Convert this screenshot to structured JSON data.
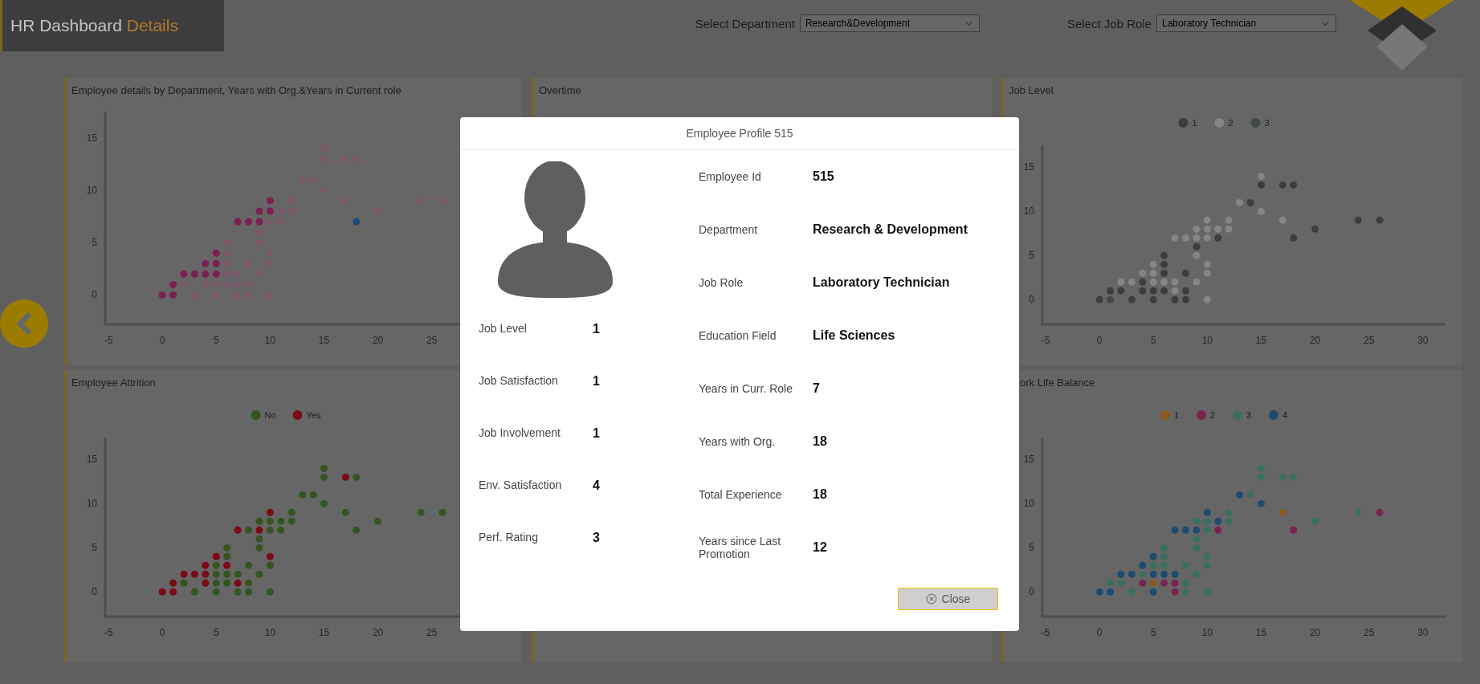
{
  "header": {
    "title": "HR Dashboard",
    "title_accent": "Details"
  },
  "filters": [
    {
      "label": "Select Department",
      "value": "Research&Development"
    },
    {
      "label": "Select Job Role",
      "value": "Laboratory Technician"
    }
  ],
  "panels": [
    {
      "title": "Employee details by Department, Years with Org.&Years in Current role",
      "chart_data": {
        "type": "scatter",
        "xlim": [
          -5.3,
          32.1
        ],
        "ylim": [
          -2.8,
          17.5
        ],
        "xticks": [
          -5,
          0,
          5,
          10,
          15,
          20,
          25
        ],
        "yticks": [
          0,
          5,
          10,
          15
        ],
        "series": [
          {
            "color": "#7d1f50",
            "x": [
              0,
              1,
              1,
              2,
              3,
              4,
              4,
              5,
              5,
              5,
              7,
              8,
              9,
              9,
              10,
              10
            ],
            "values": [
              0,
              0,
              1,
              2,
              2,
              2,
              3,
              4,
              3,
              2,
              7,
              7,
              7,
              8,
              9,
              8
            ]
          },
          {
            "color": "#1d4a7a",
            "x": [
              18
            ],
            "values": [
              7
            ]
          },
          {
            "color": "#7a5a6a",
            "x": [
              2,
              3,
              4,
              5,
              5,
              6,
              6,
              6,
              6,
              6,
              7,
              7,
              7,
              8,
              8,
              8,
              9,
              9,
              9,
              10,
              10,
              10,
              10,
              11,
              11,
              12,
              12,
              13,
              14,
              15,
              15,
              15,
              17,
              18,
              17,
              20,
              24,
              26
            ],
            "values": [
              1,
              0,
              1,
              1,
              0,
              5,
              4,
              3,
              2,
              1,
              2,
              1,
              0,
              3,
              1,
              0,
              6,
              5,
              2,
              7,
              4,
              3,
              0,
              8,
              7,
              9,
              8,
              11,
              11,
              14,
              13,
              10,
              13,
              13,
              9,
              8,
              9,
              9
            ]
          }
        ]
      }
    },
    {
      "title": "Overtime"
    },
    {
      "title": "Job Level",
      "chart_data": {
        "type": "scatter",
        "legend": "top",
        "xlim": [
          -5.3,
          32.1
        ],
        "ylim": [
          -2.8,
          17.5
        ],
        "xticks": [
          -5,
          0,
          5,
          10,
          15,
          20,
          25,
          30
        ],
        "yticks": [
          0,
          5,
          10,
          15
        ],
        "series": [
          {
            "name": "1",
            "color": "#3a3f3c",
            "x": [
              0,
              1,
              2,
              3,
              4,
              4,
              5,
              5,
              6,
              6,
              6,
              6,
              7,
              8,
              8,
              8,
              9,
              11,
              14,
              15,
              17,
              18,
              18,
              20,
              24,
              26
            ],
            "values": [
              0,
              1,
              1,
              0,
              2,
              1,
              1,
              0,
              5,
              4,
              3,
              1,
              0,
              3,
              1,
              0,
              6,
              7,
              11,
              13,
              13,
              13,
              7,
              8,
              9,
              9
            ]
          },
          {
            "name": "2",
            "color": "#858585",
            "x": [
              2,
              3,
              4,
              5,
              5,
              5,
              6,
              7,
              7,
              7,
              8,
              9,
              9,
              9,
              9,
              10,
              10,
              10,
              10,
              10,
              10,
              11,
              12,
              12,
              13,
              15,
              15,
              17
            ],
            "values": [
              2,
              2,
              3,
              4,
              3,
              2,
              2,
              2,
              1,
              7,
              7,
              7,
              8,
              5,
              2,
              9,
              8,
              7,
              4,
              3,
              0,
              8,
              9,
              8,
              11,
              14,
              10,
              9
            ]
          },
          {
            "name": "3",
            "color": "#434b48",
            "x": [
              1
            ],
            "values": [
              0
            ]
          }
        ]
      }
    },
    {
      "title": "Employee Attrition",
      "chart_data": {
        "type": "scatter",
        "legend": "top",
        "xlim": [
          -5.3,
          32.1
        ],
        "ylim": [
          -2.8,
          17.5
        ],
        "xticks": [
          -5,
          0,
          5,
          10,
          15,
          20,
          25
        ],
        "yticks": [
          0,
          5,
          10,
          15
        ],
        "series": [
          {
            "name": "No",
            "color": "#34551f",
            "x": [
              2,
              3,
              5,
              5,
              5,
              5,
              6,
              6,
              6,
              6,
              7,
              7,
              8,
              8,
              8,
              8,
              9,
              9,
              9,
              9,
              10,
              10,
              10,
              10,
              11,
              11,
              12,
              12,
              13,
              14,
              15,
              15,
              15,
              17,
              18,
              18,
              20,
              24,
              26
            ],
            "values": [
              1,
              0,
              3,
              2,
              1,
              0,
              5,
              4,
              2,
              1,
              2,
              0,
              7,
              3,
              1,
              0,
              8,
              6,
              5,
              2,
              8,
              7,
              3,
              0,
              8,
              7,
              9,
              8,
              11,
              11,
              14,
              13,
              10,
              9,
              13,
              7,
              8,
              9,
              9
            ]
          },
          {
            "name": "Yes",
            "color": "#7b0a17",
            "x": [
              0,
              1,
              1,
              2,
              3,
              4,
              4,
              4,
              5,
              6,
              7,
              7,
              9,
              10,
              10,
              17
            ],
            "values": [
              0,
              0,
              1,
              2,
              2,
              2,
              3,
              1,
              4,
              3,
              7,
              1,
              7,
              9,
              4,
              13
            ]
          }
        ]
      }
    },
    {
      "title": "ork Life Balance",
      "chart_data": {
        "type": "scatter",
        "legend": "top",
        "xlim": [
          -5.3,
          32.1
        ],
        "ylim": [
          -2.8,
          17.5
        ],
        "xticks": [
          -5,
          0,
          5,
          10,
          15,
          20,
          25,
          30
        ],
        "yticks": [
          0,
          5,
          10,
          15
        ],
        "series": [
          {
            "name": "1",
            "color": "#8a5a1e",
            "x": [
              5,
              17
            ],
            "values": [
              1,
              9
            ]
          },
          {
            "name": "2",
            "color": "#7a2350",
            "x": [
              4,
              6,
              7,
              7,
              11,
              18,
              26
            ],
            "values": [
              1,
              1,
              1,
              0,
              7,
              7,
              9
            ]
          },
          {
            "name": "3",
            "color": "#3a7060",
            "x": [
              1,
              2,
              3,
              4,
              5,
              6,
              6,
              6,
              8,
              8,
              8,
              9,
              9,
              9,
              9,
              10,
              10,
              10,
              10,
              10,
              12,
              12,
              14,
              15,
              15,
              17,
              18,
              20,
              24
            ],
            "values": [
              1,
              1,
              0,
              2,
              3,
              3,
              4,
              5,
              3,
              1,
              0,
              2,
              5,
              6,
              8,
              8,
              7,
              4,
              3,
              0,
              9,
              8,
              11,
              13,
              14,
              13,
              13,
              8,
              9
            ]
          },
          {
            "name": "4",
            "color": "#1e4c70",
            "x": [
              0,
              1,
              2,
              3,
              4,
              5,
              5,
              6,
              7,
              5,
              7,
              8,
              9,
              10,
              11,
              13,
              15
            ],
            "values": [
              0,
              0,
              2,
              2,
              3,
              4,
              2,
              2,
              2,
              0,
              7,
              7,
              7,
              9,
              8,
              11,
              10
            ]
          }
        ]
      }
    }
  ],
  "profile_dialog": {
    "title": "Employee Profile 515",
    "left_fields": [
      {
        "label": "Job Level",
        "value": "1"
      },
      {
        "label": "Job Satisfaction",
        "value": "1"
      },
      {
        "label": "Job Involvement",
        "value": "1"
      },
      {
        "label": "Env. Satisfaction",
        "value": "4"
      },
      {
        "label": "Perf. Rating",
        "value": "3"
      }
    ],
    "right_fields": [
      {
        "label": "Employee Id",
        "value": "515"
      },
      {
        "label": "Department",
        "value": "Research & Development"
      },
      {
        "label": "Job Role",
        "value": "Laboratory Technician"
      },
      {
        "label": "Education Field",
        "value": "Life Sciences"
      },
      {
        "label": "Years in Curr. Role",
        "value": "7"
      },
      {
        "label": "Years with Org.",
        "value": "18"
      },
      {
        "label": "Total Experience",
        "value": "18"
      },
      {
        "label": "Years since Last Promotion",
        "value": "12"
      }
    ],
    "close_button": "Close"
  }
}
